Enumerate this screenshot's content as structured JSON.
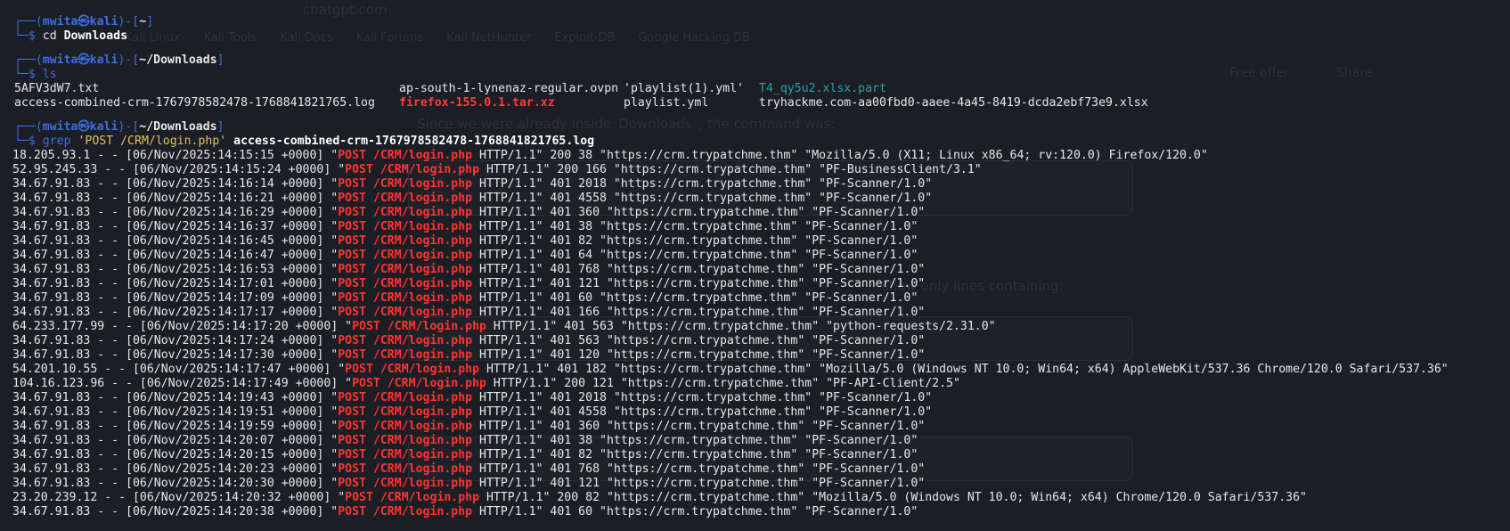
{
  "background_overlay": {
    "url_host": "chatgpt.com",
    "bookmarks": [
      "Kali Linux",
      "Kali Tools",
      "Kali Docs",
      "Kali Forums",
      "Kali NetHunter",
      "Exploit-DB",
      "Google Hacking DB"
    ],
    "free_offer": "Free offer",
    "share": "Share",
    "text1": "Since we were already inside",
    "text1_code": "Downloads",
    "text1_end": ", the command was:",
    "text2": "show only lines containing:"
  },
  "prompt": {
    "user": "mwita",
    "at": "㉿",
    "host": "kali"
  },
  "blocks": [
    {
      "dir": "~",
      "cmd": "cd",
      "args": "Downloads"
    },
    {
      "dir": "~/Downloads",
      "cmd": "ls",
      "args": ""
    },
    {
      "dir": "~/Downloads",
      "cmd": "grep",
      "args": "'POST /CRM/login.php'",
      "file": "access-combined-crm-1767978582478-1768841821765.log"
    }
  ],
  "ls_output": {
    "row1": [
      "5AFV3dW7.txt",
      "ap-south-1-lynenaz-regular.ovpn",
      "'playlist(1).yml'",
      "T4_qy5u2.xlsx.part"
    ],
    "row2": [
      "access-combined-crm-1767978582478-1768841821765.log",
      "firefox-155.0.1.tar.xz",
      "playlist.yml",
      "tryhackme.com-aa00fbd0-aaee-4a45-8419-dcda2ebf73e9.xlsx"
    ]
  },
  "grep_match": "POST /CRM/login.php",
  "log_lines": [
    {
      "pre": "18.205.93.1 - - [06/Nov/2025:14:15:15 +0000] \"",
      "post": " HTTP/1.1\" 200 38 \"https://crm.trypatchme.thm\" \"Mozilla/5.0 (X11; Linux x86_64; rv:120.0) Firefox/120.0\""
    },
    {
      "pre": "52.95.245.33 - - [06/Nov/2025:14:15:24 +0000] \"",
      "post": " HTTP/1.1\" 200 166 \"https://crm.trypatchme.thm\" \"PF-BusinessClient/3.1\""
    },
    {
      "pre": "34.67.91.83 - - [06/Nov/2025:14:16:14 +0000] \"",
      "post": " HTTP/1.1\" 401 2018 \"https://crm.trypatchme.thm\" \"PF-Scanner/1.0\""
    },
    {
      "pre": "34.67.91.83 - - [06/Nov/2025:14:16:21 +0000] \"",
      "post": " HTTP/1.1\" 401 4558 \"https://crm.trypatchme.thm\" \"PF-Scanner/1.0\""
    },
    {
      "pre": "34.67.91.83 - - [06/Nov/2025:14:16:29 +0000] \"",
      "post": " HTTP/1.1\" 401 360 \"https://crm.trypatchme.thm\" \"PF-Scanner/1.0\""
    },
    {
      "pre": "34.67.91.83 - - [06/Nov/2025:14:16:37 +0000] \"",
      "post": " HTTP/1.1\" 401 38 \"https://crm.trypatchme.thm\" \"PF-Scanner/1.0\""
    },
    {
      "pre": "34.67.91.83 - - [06/Nov/2025:14:16:45 +0000] \"",
      "post": " HTTP/1.1\" 401 82 \"https://crm.trypatchme.thm\" \"PF-Scanner/1.0\""
    },
    {
      "pre": "34.67.91.83 - - [06/Nov/2025:14:16:47 +0000] \"",
      "post": " HTTP/1.1\" 401 64 \"https://crm.trypatchme.thm\" \"PF-Scanner/1.0\""
    },
    {
      "pre": "34.67.91.83 - - [06/Nov/2025:14:16:53 +0000] \"",
      "post": " HTTP/1.1\" 401 768 \"https://crm.trypatchme.thm\" \"PF-Scanner/1.0\""
    },
    {
      "pre": "34.67.91.83 - - [06/Nov/2025:14:17:01 +0000] \"",
      "post": " HTTP/1.1\" 401 121 \"https://crm.trypatchme.thm\" \"PF-Scanner/1.0\""
    },
    {
      "pre": "34.67.91.83 - - [06/Nov/2025:14:17:09 +0000] \"",
      "post": " HTTP/1.1\" 401 60 \"https://crm.trypatchme.thm\" \"PF-Scanner/1.0\""
    },
    {
      "pre": "34.67.91.83 - - [06/Nov/2025:14:17:17 +0000] \"",
      "post": " HTTP/1.1\" 401 166 \"https://crm.trypatchme.thm\" \"PF-Scanner/1.0\""
    },
    {
      "pre": "64.233.177.99 - - [06/Nov/2025:14:17:20 +0000] \"",
      "post": " HTTP/1.1\" 401 563 \"https://crm.trypatchme.thm\" \"python-requests/2.31.0\""
    },
    {
      "pre": "34.67.91.83 - - [06/Nov/2025:14:17:24 +0000] \"",
      "post": " HTTP/1.1\" 401 563 \"https://crm.trypatchme.thm\" \"PF-Scanner/1.0\""
    },
    {
      "pre": "34.67.91.83 - - [06/Nov/2025:14:17:30 +0000] \"",
      "post": " HTTP/1.1\" 401 120 \"https://crm.trypatchme.thm\" \"PF-Scanner/1.0\""
    },
    {
      "pre": "54.201.10.55 - - [06/Nov/2025:14:17:47 +0000] \"",
      "post": " HTTP/1.1\" 401 182 \"https://crm.trypatchme.thm\" \"Mozilla/5.0 (Windows NT 10.0; Win64; x64) AppleWebKit/537.36 Chrome/120.0 Safari/537.36\""
    },
    {
      "pre": "104.16.123.96 - - [06/Nov/2025:14:17:49 +0000] \"",
      "post": " HTTP/1.1\" 200 121 \"https://crm.trypatchme.thm\" \"PF-API-Client/2.5\""
    },
    {
      "pre": "34.67.91.83 - - [06/Nov/2025:14:19:43 +0000] \"",
      "post": " HTTP/1.1\" 401 2018 \"https://crm.trypatchme.thm\" \"PF-Scanner/1.0\""
    },
    {
      "pre": "34.67.91.83 - - [06/Nov/2025:14:19:51 +0000] \"",
      "post": " HTTP/1.1\" 401 4558 \"https://crm.trypatchme.thm\" \"PF-Scanner/1.0\""
    },
    {
      "pre": "34.67.91.83 - - [06/Nov/2025:14:19:59 +0000] \"",
      "post": " HTTP/1.1\" 401 360 \"https://crm.trypatchme.thm\" \"PF-Scanner/1.0\""
    },
    {
      "pre": "34.67.91.83 - - [06/Nov/2025:14:20:07 +0000] \"",
      "post": " HTTP/1.1\" 401 38 \"https://crm.trypatchme.thm\" \"PF-Scanner/1.0\""
    },
    {
      "pre": "34.67.91.83 - - [06/Nov/2025:14:20:15 +0000] \"",
      "post": " HTTP/1.1\" 401 82 \"https://crm.trypatchme.thm\" \"PF-Scanner/1.0\""
    },
    {
      "pre": "34.67.91.83 - - [06/Nov/2025:14:20:23 +0000] \"",
      "post": " HTTP/1.1\" 401 768 \"https://crm.trypatchme.thm\" \"PF-Scanner/1.0\""
    },
    {
      "pre": "34.67.91.83 - - [06/Nov/2025:14:20:30 +0000] \"",
      "post": " HTTP/1.1\" 401 121 \"https://crm.trypatchme.thm\" \"PF-Scanner/1.0\""
    },
    {
      "pre": "23.20.239.12 - - [06/Nov/2025:14:20:32 +0000] \"",
      "post": " HTTP/1.1\" 200 82 \"https://crm.trypatchme.thm\" \"Mozilla/5.0 (Windows NT 10.0; Win64; x64) Chrome/120.0 Safari/537.36\""
    },
    {
      "pre": "34.67.91.83 - - [06/Nov/2025:14:20:38 +0000] \"",
      "post": " HTTP/1.1\" 401 60 \"https://crm.trypatchme.thm\" \"PF-Scanner/1.0\""
    }
  ],
  "colors": {
    "background": "#1b1e24",
    "prompt_blue": "#3b6ee0",
    "match_red": "#ff3333",
    "archive_red": "#ff3b3b",
    "partial_teal": "#2aa0a8"
  }
}
